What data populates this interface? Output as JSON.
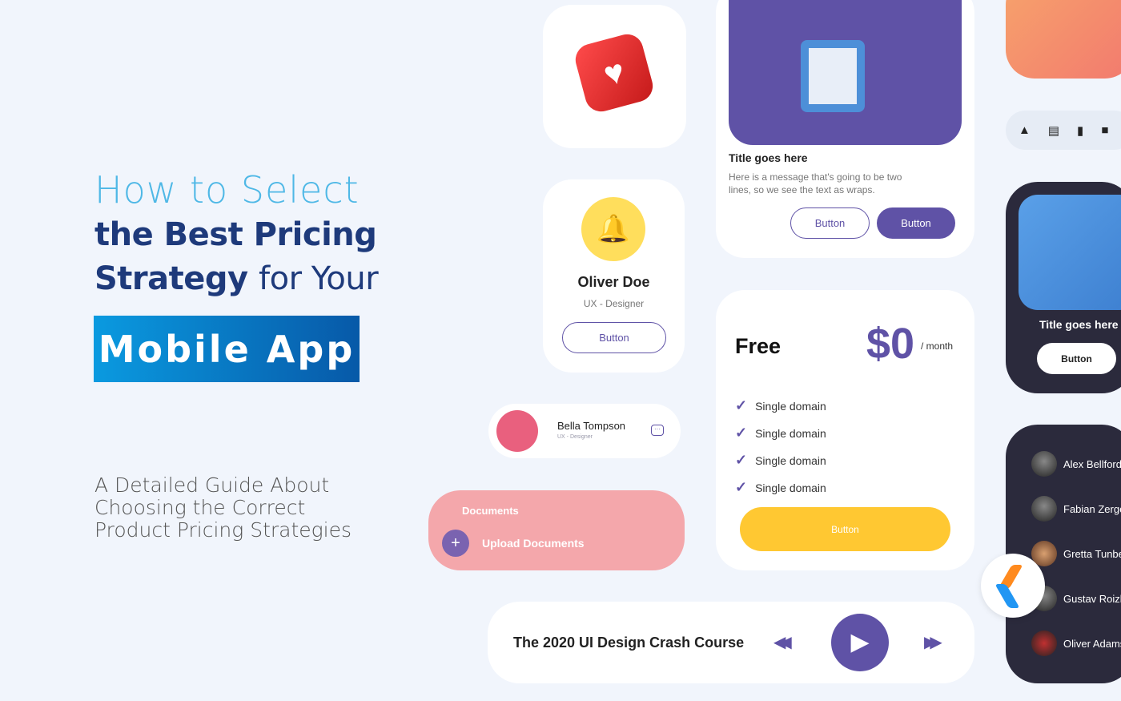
{
  "headline": {
    "line1": "How to Select",
    "line2": "the Best Pricing",
    "line3_bold": "Strategy",
    "line3_light": "for Your",
    "badge": "Mobile App"
  },
  "subtitle": [
    "A Detailed Guide About",
    "Choosing the Correct",
    "Product Pricing Strategies"
  ],
  "profile_card": {
    "name": "Oliver Doe",
    "role": "UX - Designer",
    "button": "Button"
  },
  "contact_card": {
    "name": "Bella Tompson",
    "role": "UX - Designer",
    "icon": "chat-icon"
  },
  "documents_card": {
    "title": "Documents",
    "action": "Upload Documents",
    "color": "#f4a7ab"
  },
  "info_card": {
    "title": "Title goes here",
    "message": "Here is a message that's going to be two lines, so we see the text as wraps.",
    "button_outline": "Button",
    "button_filled": "Button"
  },
  "pricing": {
    "plan": "Free",
    "price": "$0",
    "period": "/ month",
    "features": [
      "Single domain",
      "Single domain",
      "Single domain",
      "Single domain"
    ],
    "button": "Button",
    "accent": "#5f52a6",
    "button_color": "#ffc832"
  },
  "course": {
    "title": "The 2020 UI Design Crash Course"
  },
  "dark_card": {
    "title": "Title goes here",
    "button": "Button"
  },
  "people": [
    "Alex Bellford",
    "Fabian Zerge",
    "Gretta Tunbe",
    "Gustav Roizb",
    "Oliver Adams"
  ],
  "toolbar_icons": [
    "image-icon",
    "document-icon",
    "file-icon",
    "folder-icon"
  ]
}
